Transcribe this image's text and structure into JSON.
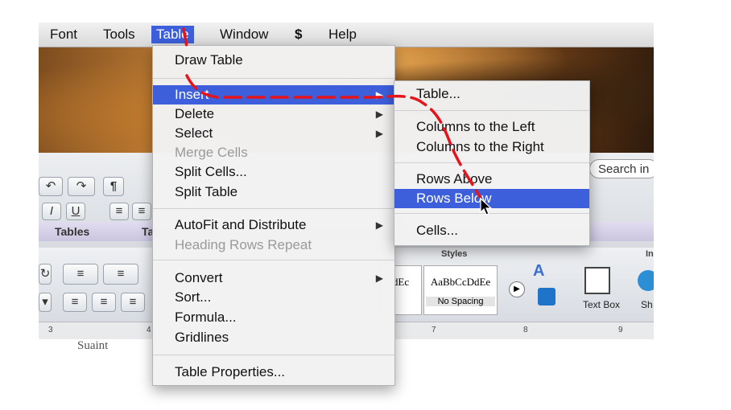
{
  "menubar": {
    "items": [
      "Font",
      "Tools",
      "Table",
      "Window",
      "Help"
    ],
    "script_icon": "script-icon"
  },
  "toolbar": {
    "search_placeholder": "Search in",
    "paragraph_symbol": "¶",
    "italic": "I",
    "underline": "U"
  },
  "tabs": {
    "tables": "Tables",
    "table_partial": "Tab"
  },
  "ribbon": {
    "styles_label": "Styles",
    "insert_label": "In",
    "style1_sample": "dEc",
    "style2_sample": "AaBbCcDdEe",
    "style2_name": "No Spacing",
    "text_box": "Text Box",
    "shape_partial": "Sh"
  },
  "ruler": [
    "3",
    "4",
    "7",
    "8",
    "9"
  ],
  "page_text": "Suaint",
  "table_menu": {
    "items": [
      "Draw Table",
      "Insert",
      "Delete",
      "Select",
      "Merge Cells",
      "Split Cells...",
      "Split Table",
      "AutoFit and Distribute",
      "Heading Rows Repeat",
      "Convert",
      "Sort...",
      "Formula...",
      "Gridlines",
      "Table Properties..."
    ]
  },
  "insert_submenu": {
    "items": [
      "Table...",
      "Columns to the Left",
      "Columns to the Right",
      "Rows Above",
      "Rows Below",
      "Cells..."
    ]
  },
  "colors": {
    "highlight": "#3d5fdb",
    "annotation": "#e5141b"
  }
}
